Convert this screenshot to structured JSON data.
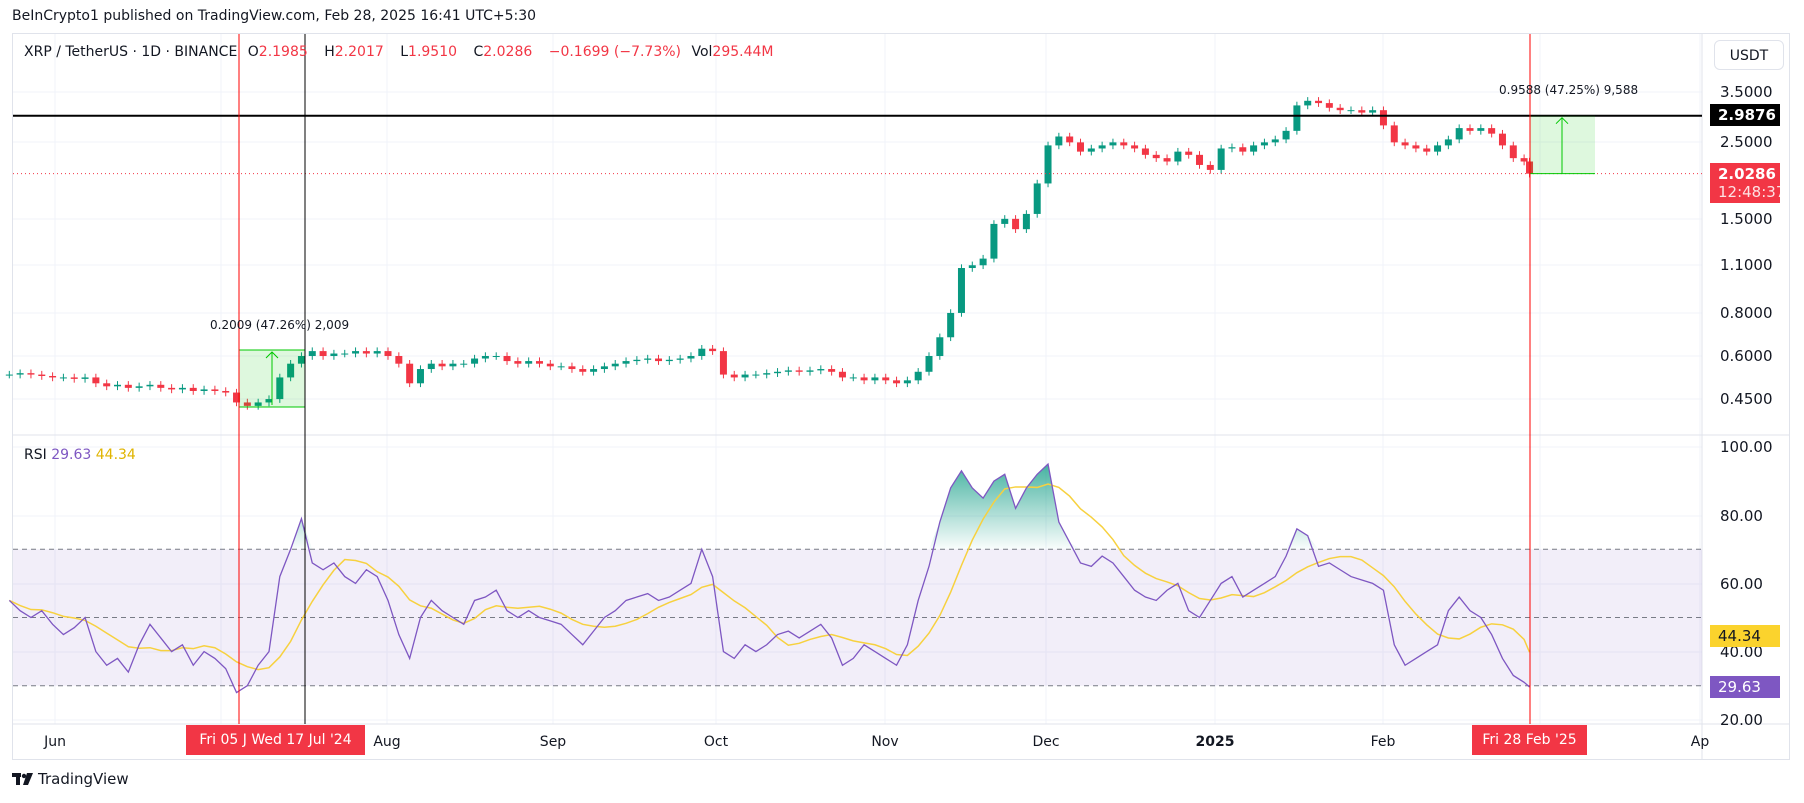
{
  "header": {
    "published": "BeInCrypto1 published on TradingView.com, Feb 28, 2025 16:41 UTC+5:30"
  },
  "legend": {
    "symbol": "XRP / TetherUS · 1D · BINANCE",
    "o_label": "O",
    "o": "2.1985",
    "h_label": "H",
    "h": "2.2017",
    "l_label": "L",
    "l": "1.9510",
    "c_label": "C",
    "c": "2.0286",
    "change": "−0.1699 (−7.73%)",
    "vol_label": "Vol",
    "vol": "295.44M"
  },
  "price_axis": {
    "currency": "USDT",
    "ticks": [
      "3.5000",
      "2.5000",
      "1.5000",
      "1.1000",
      "0.8000",
      "0.6000",
      "0.4500"
    ],
    "level_line": "2.9876",
    "last_price": "2.0286",
    "countdown": "12:48:37"
  },
  "rsi": {
    "label": "RSI",
    "value": "29.63",
    "ma_value": "44.34",
    "ticks": [
      "100.00",
      "80.00",
      "60.00",
      "40.00",
      "20.00"
    ]
  },
  "measures": [
    {
      "label": "0.2009 (47.26%) 2,009"
    },
    {
      "label": "0.9588 (47.25%) 9,588"
    }
  ],
  "time_axis": {
    "labels": [
      "Jun",
      "Aug",
      "Sep",
      "Oct",
      "Nov",
      "Dec",
      "2025",
      "Feb",
      "Ap"
    ],
    "highlight_1": "Fri 05 J",
    "highlight_2": "Wed 17 Jul '24",
    "highlight_3": "Fri 28 Feb '25"
  },
  "branding": {
    "logo_text": "TradingView"
  },
  "colors": {
    "up": "#089981",
    "down": "#f23645",
    "rsi": "#7e57c2",
    "rsi_ma": "#f7d13f",
    "level": "#000000",
    "measure": "#00c800"
  },
  "chart_data": [
    {
      "type": "candlestick",
      "scale": "log",
      "ylim": [
        0.42,
        3.7
      ],
      "level_line": 2.9876,
      "last": 2.0286,
      "months": [
        {
          "month": "2024-05",
          "days": [
            23,
            25,
            27,
            29,
            31
          ],
          "close": [
            0.53,
            0.535,
            0.53,
            0.525,
            0.52
          ]
        },
        {
          "month": "2024-06",
          "days": [
            2,
            4,
            6,
            8,
            10,
            12,
            14,
            16,
            18,
            20,
            22,
            24,
            26,
            28,
            30
          ],
          "close": [
            0.52,
            0.515,
            0.52,
            0.5,
            0.49,
            0.495,
            0.485,
            0.49,
            0.495,
            0.485,
            0.48,
            0.485,
            0.475,
            0.48,
            0.475
          ]
        },
        {
          "month": "2024-07",
          "days": [
            2,
            4,
            6,
            8,
            10,
            12,
            14,
            16,
            18,
            20,
            22,
            24,
            26,
            28,
            30
          ],
          "close": [
            0.47,
            0.44,
            0.43,
            0.44,
            0.45,
            0.52,
            0.57,
            0.6,
            0.62,
            0.6,
            0.61,
            0.61,
            0.62,
            0.61,
            0.62
          ]
        },
        {
          "month": "2024-08",
          "days": [
            1,
            3,
            5,
            7,
            9,
            11,
            13,
            15,
            17,
            19,
            21,
            23,
            25,
            27,
            29,
            31
          ],
          "close": [
            0.6,
            0.57,
            0.5,
            0.55,
            0.57,
            0.56,
            0.57,
            0.57,
            0.59,
            0.6,
            0.6,
            0.58,
            0.57,
            0.58,
            0.57,
            0.56
          ]
        },
        {
          "month": "2024-09",
          "days": [
            2,
            4,
            6,
            8,
            10,
            12,
            14,
            16,
            18,
            20,
            22,
            24,
            26,
            28,
            30
          ],
          "close": [
            0.56,
            0.55,
            0.54,
            0.55,
            0.56,
            0.57,
            0.58,
            0.585,
            0.59,
            0.58,
            0.585,
            0.59,
            0.6,
            0.63,
            0.62
          ]
        },
        {
          "month": "2024-10",
          "days": [
            2,
            4,
            6,
            8,
            10,
            12,
            14,
            16,
            18,
            20,
            22,
            24,
            26,
            28,
            30
          ],
          "close": [
            0.53,
            0.52,
            0.53,
            0.53,
            0.535,
            0.54,
            0.545,
            0.54,
            0.545,
            0.55,
            0.54,
            0.52,
            0.52,
            0.51,
            0.52
          ]
        },
        {
          "month": "2024-11",
          "days": [
            1,
            3,
            5,
            7,
            9,
            11,
            13,
            15,
            17,
            19,
            21,
            23,
            25,
            27,
            29
          ],
          "close": [
            0.51,
            0.5,
            0.51,
            0.54,
            0.6,
            0.68,
            0.8,
            1.08,
            1.1,
            1.15,
            1.45,
            1.5,
            1.4,
            1.55,
            1.9
          ]
        },
        {
          "month": "2024-12",
          "days": [
            1,
            3,
            5,
            7,
            9,
            11,
            13,
            15,
            17,
            19,
            21,
            23,
            25,
            27,
            29,
            31
          ],
          "close": [
            2.45,
            2.6,
            2.5,
            2.35,
            2.4,
            2.45,
            2.5,
            2.45,
            2.4,
            2.3,
            2.25,
            2.2,
            2.35,
            2.3,
            2.15,
            2.08
          ]
        },
        {
          "month": "2025-01",
          "days": [
            2,
            4,
            6,
            8,
            10,
            12,
            14,
            16,
            18,
            20,
            22,
            24,
            26,
            28,
            30
          ],
          "close": [
            2.4,
            2.42,
            2.35,
            2.45,
            2.5,
            2.55,
            2.7,
            3.2,
            3.3,
            3.25,
            3.15,
            3.1,
            3.1,
            3.05,
            3.1
          ]
        },
        {
          "month": "2025-02",
          "days": [
            1,
            3,
            5,
            7,
            9,
            11,
            13,
            15,
            17,
            19,
            21,
            23,
            25,
            27,
            28
          ],
          "close": [
            2.8,
            2.5,
            2.45,
            2.4,
            2.35,
            2.45,
            2.55,
            2.75,
            2.7,
            2.75,
            2.65,
            2.45,
            2.25,
            2.2,
            2.0286
          ]
        }
      ]
    },
    {
      "type": "line",
      "name": "RSI",
      "ylim": [
        20,
        100
      ],
      "bands": [
        30,
        50,
        70
      ],
      "months": [
        {
          "month": "2024-05",
          "rsi": [
            55,
            52,
            50,
            52,
            48
          ]
        },
        {
          "month": "2024-06",
          "rsi": [
            45,
            47,
            50,
            40,
            36,
            38,
            34,
            42,
            48,
            44,
            40,
            42,
            36,
            40,
            38
          ]
        },
        {
          "month": "2024-07",
          "rsi": [
            35,
            28,
            30,
            36,
            40,
            62,
            70,
            79,
            66,
            64,
            66,
            62,
            60,
            64,
            62
          ]
        },
        {
          "month": "2024-08",
          "rsi": [
            55,
            45,
            38,
            50,
            55,
            52,
            50,
            48,
            55,
            56,
            58,
            52,
            50,
            52,
            50,
            49
          ]
        },
        {
          "month": "2024-09",
          "rsi": [
            48,
            45,
            42,
            46,
            50,
            52,
            55,
            56,
            57,
            55,
            56,
            58,
            60,
            70,
            62
          ]
        },
        {
          "month": "2024-10",
          "rsi": [
            40,
            38,
            42,
            40,
            42,
            45,
            46,
            44,
            46,
            48,
            44,
            36,
            38,
            42,
            40
          ]
        },
        {
          "month": "2024-11",
          "rsi": [
            38,
            36,
            42,
            55,
            65,
            78,
            88,
            93,
            88,
            85,
            90,
            92,
            82,
            88,
            92
          ]
        },
        {
          "month": "2024-12",
          "rsi": [
            95,
            78,
            72,
            66,
            65,
            68,
            66,
            62,
            58,
            56,
            55,
            58,
            60,
            52,
            50,
            55
          ]
        },
        {
          "month": "2025-01",
          "rsi": [
            60,
            62,
            56,
            58,
            60,
            62,
            68,
            76,
            74,
            65,
            66,
            64,
            62,
            61,
            60
          ]
        },
        {
          "month": "2025-02",
          "rsi": [
            58,
            42,
            36,
            38,
            40,
            42,
            52,
            56,
            52,
            50,
            45,
            38,
            33,
            31,
            29.63
          ]
        }
      ]
    }
  ]
}
